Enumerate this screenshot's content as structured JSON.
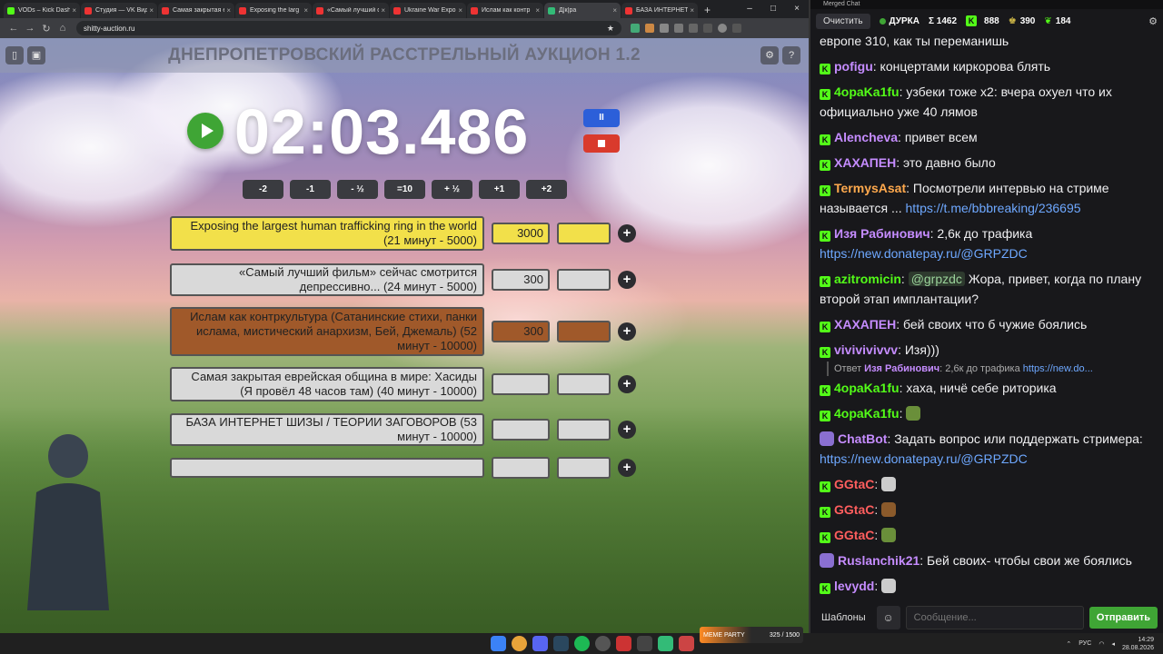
{
  "browser": {
    "tabs": [
      {
        "label": "VODs – Kick Dashb",
        "color": "#53fc18",
        "active": false
      },
      {
        "label": "Студия — VK Видео",
        "color": "#e33",
        "active": false
      },
      {
        "label": "Самая закрытая е",
        "color": "#e33",
        "active": false
      },
      {
        "label": "Exposing the larg",
        "color": "#e33",
        "active": false
      },
      {
        "label": "«Самый лучший ф",
        "color": "#e33",
        "active": false
      },
      {
        "label": "Ukraine War Expo",
        "color": "#e33",
        "active": false
      },
      {
        "label": "Ислам как контр",
        "color": "#e33",
        "active": false
      },
      {
        "label": "Д|к|ра",
        "color": "#3b7",
        "active": true
      },
      {
        "label": "БАЗА ИНТЕРНЕТ",
        "color": "#e33",
        "active": false
      }
    ],
    "url": "shitty-auction.ru"
  },
  "auction": {
    "title": "ДНЕПРОПЕТРОВСКИЙ РАССТРЕЛЬНЫЙ АУКЦИОН 1.2",
    "timer": "02:03.486",
    "pause_label": "II",
    "adjust": [
      "-2",
      "-1",
      "- ½",
      "=10",
      "+ ½",
      "+1",
      "+2"
    ],
    "lots": [
      {
        "name": "Exposing the largest human trafficking ring in the world (21 минут - 5000)",
        "value": "3000",
        "color": "#f2e04a"
      },
      {
        "name": "«Самый лучший фильм» сейчас смотрится депрессивно... (24 минут - 5000)",
        "value": "300",
        "color": "#d9d9d9"
      },
      {
        "name": "Ислам как контркультура (Сатанинские стихи, панки ислама, мистический анархизм,  Бей, Джемаль) (52 минут - 10000)",
        "value": "300",
        "color": "#a0592a"
      },
      {
        "name": "Самая закрытая еврейская община в мире: Хасиды (Я провёл 48 часов там) (40 минут - 10000)",
        "value": "",
        "color": "#d9d9d9"
      },
      {
        "name": "БАЗА ИНТЕРНЕТ ШИЗЫ / ТЕОРИИ ЗАГОВОРОВ (53 минут - 10000)",
        "value": "",
        "color": "#d9d9d9"
      },
      {
        "name": "",
        "value": "",
        "color": "#d9d9d9"
      }
    ]
  },
  "chat": {
    "window_title": "Merged Chat",
    "clear_label": "Очистить",
    "channel": "ДУРКА",
    "stats": [
      "Σ 1462",
      "888",
      "390",
      "184"
    ],
    "messages": [
      {
        "nick": "",
        "color": "#ffffff",
        "text": "европе 310, как ты переманишь",
        "badge": false
      },
      {
        "nick": "pofigu",
        "color": "#c58cff",
        "text": "концертами киркорова блять",
        "badge": true
      },
      {
        "nick": "4opaKa1fu",
        "color": "#53fc18",
        "text": "узбеки тоже x2: вчера охуел что их официально уже 40 лямов",
        "badge": true
      },
      {
        "nick": "Alencheva",
        "color": "#c58cff",
        "text": "привет всем",
        "badge": true
      },
      {
        "nick": "ХАХАПЕН",
        "color": "#c58cff",
        "text": "это давно было",
        "badge": true
      },
      {
        "nick": "TermysAsat",
        "color": "#ffa94d",
        "text": "Посмотрели интервью на стриме называется ... ",
        "link": "https://t.me/bbbreaking/236695",
        "badge": true
      },
      {
        "nick": "Изя Рабинович",
        "color": "#c58cff",
        "text": "2,6к до трафика ",
        "link": "https://new.donatepay.ru/@GRPZDC",
        "badge": true
      },
      {
        "nick": "azitromicin",
        "color": "#53fc18",
        "mention": "@grpzdc",
        "text": " Жора, привет, когда по плану второй этап имплантации?",
        "badge": true
      },
      {
        "nick": "ХАХАПЕН",
        "color": "#c58cff",
        "text": "бей своих что б чужие боялись",
        "badge": true
      },
      {
        "nick": "vivivivivvv",
        "color": "#c58cff",
        "text": "Изя)))",
        "badge": true
      },
      {
        "nick": "4opaKa1fu",
        "color": "#53fc18",
        "text": "хаха, ничё себе риторика",
        "badge": true
      },
      {
        "nick": "4opaKa1fu",
        "color": "#53fc18",
        "text": "",
        "badge": true
      },
      {
        "nick": "ChatBot",
        "color": "#c58cff",
        "text": "Задать вопрос или поддержать стримера: ",
        "link": "https://new.donatepay.ru/@GRPZDC",
        "badge": false
      },
      {
        "nick": "GGtaC",
        "color": "#ff5e5e",
        "text": "",
        "badge": true
      },
      {
        "nick": "GGtaC",
        "color": "#ff5e5e",
        "text": "",
        "badge": true
      },
      {
        "nick": "GGtaC",
        "color": "#ff5e5e",
        "text": "",
        "badge": true
      },
      {
        "nick": "Ruslanchik21",
        "color": "#c58cff",
        "text": "Бей своих- чтобы свои же боялись",
        "badge": false
      },
      {
        "nick": "levydd",
        "color": "#c58cff",
        "text": "",
        "badge": true
      }
    ],
    "reply": {
      "prefix": "Ответ",
      "nick": "Изя Рабинович",
      "text": "2,6к до трафика",
      "link": "https://new.do..."
    },
    "templates_label": "Шаблоны",
    "input_placeholder": "Сообщение...",
    "send_label": "Отправить"
  },
  "taskbar": {
    "banner_left": "MEME PARTY",
    "banner_right": "325 / 1500",
    "lang": "РУС",
    "time": "14:29",
    "date": "28.08.2026"
  }
}
